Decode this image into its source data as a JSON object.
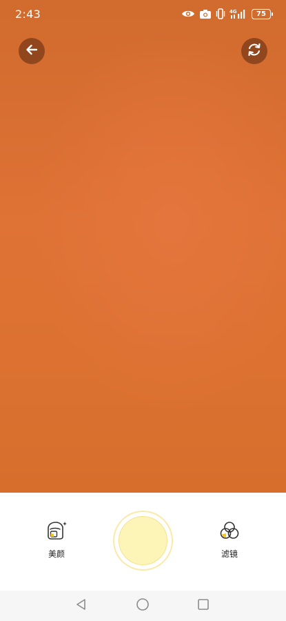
{
  "status_bar": {
    "time": "2:43",
    "network": "4G",
    "battery": "75",
    "icons": [
      "eye-icon",
      "camera-icon",
      "vibrate-icon",
      "signal-icon",
      "battery-icon"
    ]
  },
  "camera": {
    "back_icon": "arrow-left-icon",
    "switch_icon": "camera-switch-icon",
    "viewfinder_color": "#df7235"
  },
  "tools": {
    "beauty_label": "美颜",
    "beauty_icon": "beauty-icon",
    "filter_label": "滤镜",
    "filter_icon": "filter-icon"
  },
  "shutter": {
    "color": "#fdf4b8"
  },
  "nav_bar": {
    "icons": [
      "nav-back-icon",
      "nav-home-icon",
      "nav-recent-icon"
    ]
  }
}
